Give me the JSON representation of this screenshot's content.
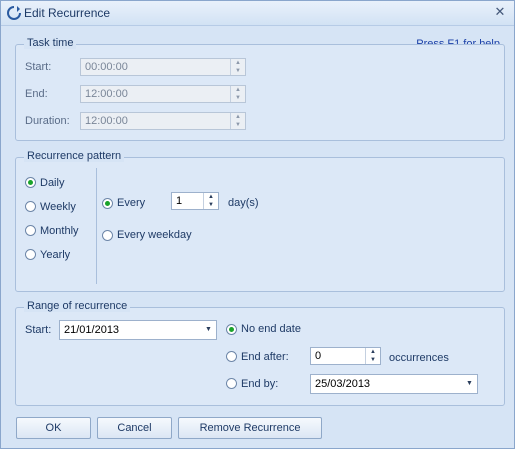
{
  "window": {
    "title": "Edit Recurrence",
    "close_icon": "✕"
  },
  "help_link": "Press F1 for help",
  "task_time": {
    "legend": "Task time",
    "start_label": "Start:",
    "start_value": "00:00:00",
    "end_label": "End:",
    "end_value": "12:00:00",
    "duration_label": "Duration:",
    "duration_value": "12:00:00"
  },
  "recurrence_pattern": {
    "legend": "Recurrence pattern",
    "options": [
      "Daily",
      "Weekly",
      "Monthly",
      "Yearly"
    ],
    "selected": "Daily",
    "every_label": "Every",
    "every_value": "1",
    "every_unit": "day(s)",
    "every_weekday_label": "Every weekday"
  },
  "range": {
    "legend": "Range of recurrence",
    "start_label": "Start:",
    "start_value": "21/01/2013",
    "no_end_label": "No end date",
    "end_after_label": "End after:",
    "end_after_value": "0",
    "occurrences_label": "occurrences",
    "end_by_label": "End by:",
    "end_by_value": "25/03/2013",
    "selected": "No end date"
  },
  "buttons": {
    "ok": "OK",
    "cancel": "Cancel",
    "remove": "Remove Recurrence"
  },
  "colors": {
    "accent": "#1aa32a",
    "background": "#d6e4f5",
    "link": "#1a3fa8"
  }
}
